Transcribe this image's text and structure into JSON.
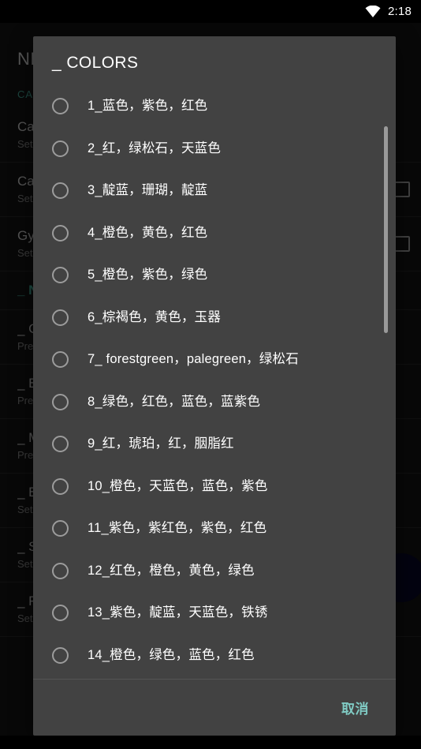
{
  "statusbar": {
    "time": "2:18",
    "wifi_icon": "wifi-icon"
  },
  "background": {
    "title": "NEW",
    "section_header": "CAMERA",
    "fab_icon": "floating-action-button",
    "rows": [
      {
        "title": "Camera",
        "subtitle": "Set camera rotation",
        "has_checkbox": false,
        "accent": false
      },
      {
        "title": "Camera",
        "subtitle": "Set",
        "has_checkbox": true,
        "accent": false
      },
      {
        "title": "Gyro",
        "subtitle": "Set",
        "has_checkbox": true,
        "accent": false
      },
      {
        "title": "_ NEW",
        "subtitle": "",
        "has_checkbox": false,
        "accent": true
      },
      {
        "title": "_ COLORS",
        "subtitle": "Press",
        "has_checkbox": false,
        "accent": false
      },
      {
        "title": "_ BG",
        "subtitle": "Press",
        "has_checkbox": false,
        "accent": false
      },
      {
        "title": "_ MODE",
        "subtitle": "Press",
        "has_checkbox": false,
        "accent": false
      },
      {
        "title": "_ BLUR",
        "subtitle": "Set",
        "has_checkbox": false,
        "accent": false
      },
      {
        "title": "_ SPEED",
        "subtitle": "Set",
        "has_checkbox": false,
        "accent": false
      },
      {
        "title": "_ RATE",
        "subtitle": "Set",
        "has_checkbox": false,
        "accent": false
      }
    ]
  },
  "dialog": {
    "title": "_ COLORS",
    "scrollbar": "vertical-scrollbar",
    "options": [
      {
        "id": 1,
        "label": "1_蓝色，紫色，红色"
      },
      {
        "id": 2,
        "label": "2_红，绿松石，天蓝色"
      },
      {
        "id": 3,
        "label": "3_靛蓝，珊瑚，靛蓝"
      },
      {
        "id": 4,
        "label": "4_橙色，黄色，红色"
      },
      {
        "id": 5,
        "label": "5_橙色，紫色，绿色"
      },
      {
        "id": 6,
        "label": "6_棕褐色，黄色，玉器"
      },
      {
        "id": 7,
        "label": "7_ forestgreen，palegreen，绿松石"
      },
      {
        "id": 8,
        "label": "8_绿色，红色，蓝色，蓝紫色"
      },
      {
        "id": 9,
        "label": "9_红，琥珀，红，胭脂红"
      },
      {
        "id": 10,
        "label": "10_橙色，天蓝色，蓝色，紫色"
      },
      {
        "id": 11,
        "label": "11_紫色，紫红色，紫色，红色"
      },
      {
        "id": 12,
        "label": "12_红色，橙色，黄色，绿色"
      },
      {
        "id": 13,
        "label": "13_紫色，靛蓝，天蓝色，铁锈"
      },
      {
        "id": 14,
        "label": "14_橙色，绿色，蓝色，红色"
      }
    ],
    "selected": null,
    "cancel_label": "取消"
  },
  "colors": {
    "dialog_bg": "#424242",
    "accent_teal": "#80cbc4",
    "section_teal": "#2e6f64",
    "text_primary": "#ffffff",
    "screen_bg": "#0e0e0e",
    "statusbar_bg": "#000000"
  }
}
